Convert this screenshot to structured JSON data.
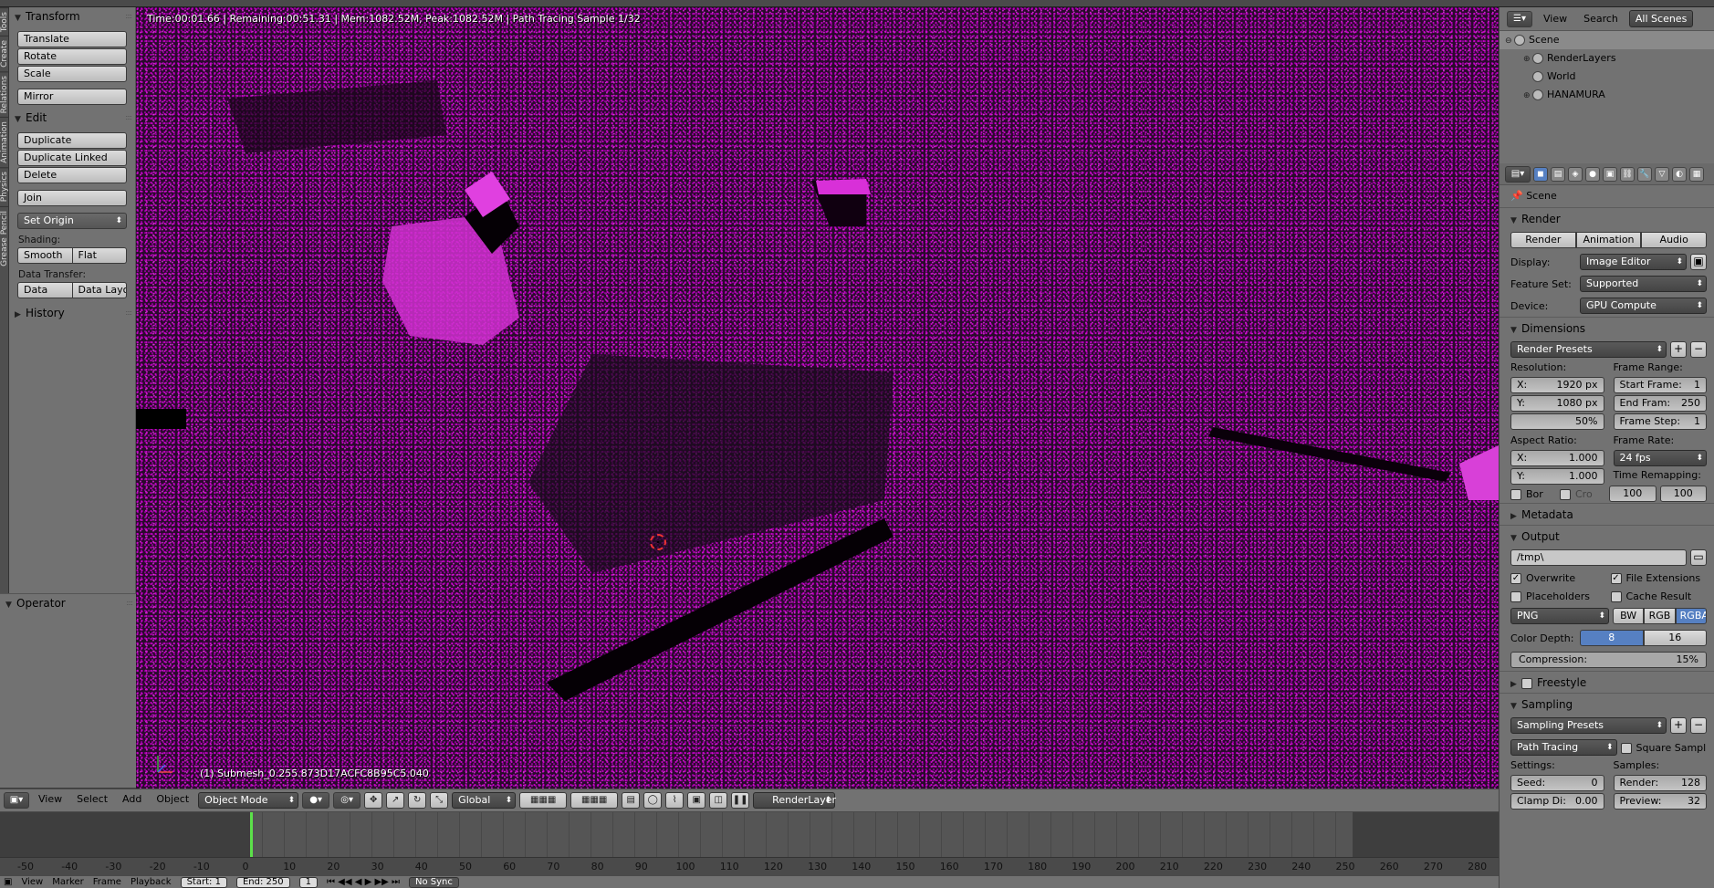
{
  "tool_tabs": [
    "Tools",
    "Create",
    "Relations",
    "Animation",
    "Physics",
    "Grease Pencil"
  ],
  "transform": {
    "title": "Transform",
    "buttons": [
      "Translate",
      "Rotate",
      "Scale"
    ],
    "mirror": "Mirror"
  },
  "edit": {
    "title": "Edit",
    "buttons": [
      "Duplicate",
      "Duplicate Linked",
      "Delete"
    ],
    "join": "Join",
    "set_origin": "Set Origin",
    "shading_label": "Shading:",
    "smooth": "Smooth",
    "flat": "Flat",
    "data_transfer_label": "Data Transfer:",
    "data": "Data",
    "data_layout": "Data Layo"
  },
  "history": {
    "title": "History"
  },
  "operator": {
    "title": "Operator"
  },
  "viewport": {
    "status": "Time:00:01.66 | Remaining:00:51.31 | Mem:1082.52M, Peak:1082.52M | Path Tracing Sample 1/32",
    "object_info": "(1) Submesh_0.255.873D17ACFC8B95C5.040"
  },
  "vp_header": {
    "view": "View",
    "select": "Select",
    "add": "Add",
    "object": "Object",
    "mode": "Object Mode",
    "orientation": "Global",
    "render_layer": "RenderLayer"
  },
  "timeline": {
    "ticks": [
      "-50",
      "-40",
      "-30",
      "-20",
      "-10",
      "0",
      "10",
      "20",
      "30",
      "40",
      "50",
      "60",
      "70",
      "80",
      "90",
      "100",
      "110",
      "120",
      "130",
      "140",
      "150",
      "160",
      "170",
      "180",
      "190",
      "200",
      "210",
      "220",
      "230",
      "240",
      "250",
      "260",
      "270",
      "280"
    ],
    "current_frame": 1
  },
  "bottom": {
    "view": "View",
    "marker": "Marker",
    "frame": "Frame",
    "playback": "Playback",
    "start": "Start:",
    "start_val": "1",
    "end": "End:",
    "end_val": "250",
    "frame_val": "1",
    "sync": "No Sync"
  },
  "outliner": {
    "view": "View",
    "search": "Search",
    "filter": "All Scenes",
    "items": [
      {
        "label": "Scene",
        "level": 0
      },
      {
        "label": "RenderLayers",
        "level": 1
      },
      {
        "label": "World",
        "level": 1
      },
      {
        "label": "HANAMURA",
        "level": 1
      }
    ]
  },
  "props": {
    "context": "Scene",
    "render": {
      "title": "Render",
      "render_btn": "Render",
      "animation_btn": "Animation",
      "audio_btn": "Audio",
      "display_label": "Display:",
      "display": "Image Editor",
      "feature_label": "Feature Set:",
      "feature": "Supported",
      "device_label": "Device:",
      "device": "GPU Compute"
    },
    "dimensions": {
      "title": "Dimensions",
      "presets": "Render Presets",
      "resolution_label": "Resolution:",
      "res_x_label": "X:",
      "res_x": "1920 px",
      "res_y_label": "Y:",
      "res_y": "1080 px",
      "res_pct": "50%",
      "frame_range_label": "Frame Range:",
      "start_label": "Start Frame:",
      "start": "1",
      "end_label": "End Fram:",
      "end": "250",
      "step_label": "Frame Step:",
      "step": "1",
      "aspect_label": "Aspect Ratio:",
      "asp_x_label": "X:",
      "asp_x": "1.000",
      "asp_y_label": "Y:",
      "asp_y": "1.000",
      "frame_rate_label": "Frame Rate:",
      "frame_rate": "24 fps",
      "time_remap_label": "Time Remapping:",
      "remap_old": "100",
      "remap_new": "100",
      "border": "Bor",
      "crop": "Cro"
    },
    "metadata": {
      "title": "Metadata"
    },
    "output": {
      "title": "Output",
      "path": "/tmp\\",
      "overwrite": "Overwrite",
      "file_ext": "File Extensions",
      "placeholders": "Placeholders",
      "cache": "Cache Result",
      "format": "PNG",
      "bw": "BW",
      "rgb": "RGB",
      "rgba": "RGBA",
      "depth_label": "Color Depth:",
      "depth8": "8",
      "depth16": "16",
      "compression_label": "Compression:",
      "compression": "15%"
    },
    "freestyle": {
      "title": "Freestyle"
    },
    "sampling": {
      "title": "Sampling",
      "presets": "Sampling Presets",
      "method": "Path Tracing",
      "square": "Square Sampl...",
      "settings_label": "Settings:",
      "seed_label": "Seed:",
      "seed": "0",
      "clamp_label": "Clamp Di:",
      "clamp": "0.00",
      "samples_label": "Samples:",
      "render_label": "Render:",
      "render": "128",
      "preview_label": "Preview:",
      "preview": "32"
    }
  }
}
